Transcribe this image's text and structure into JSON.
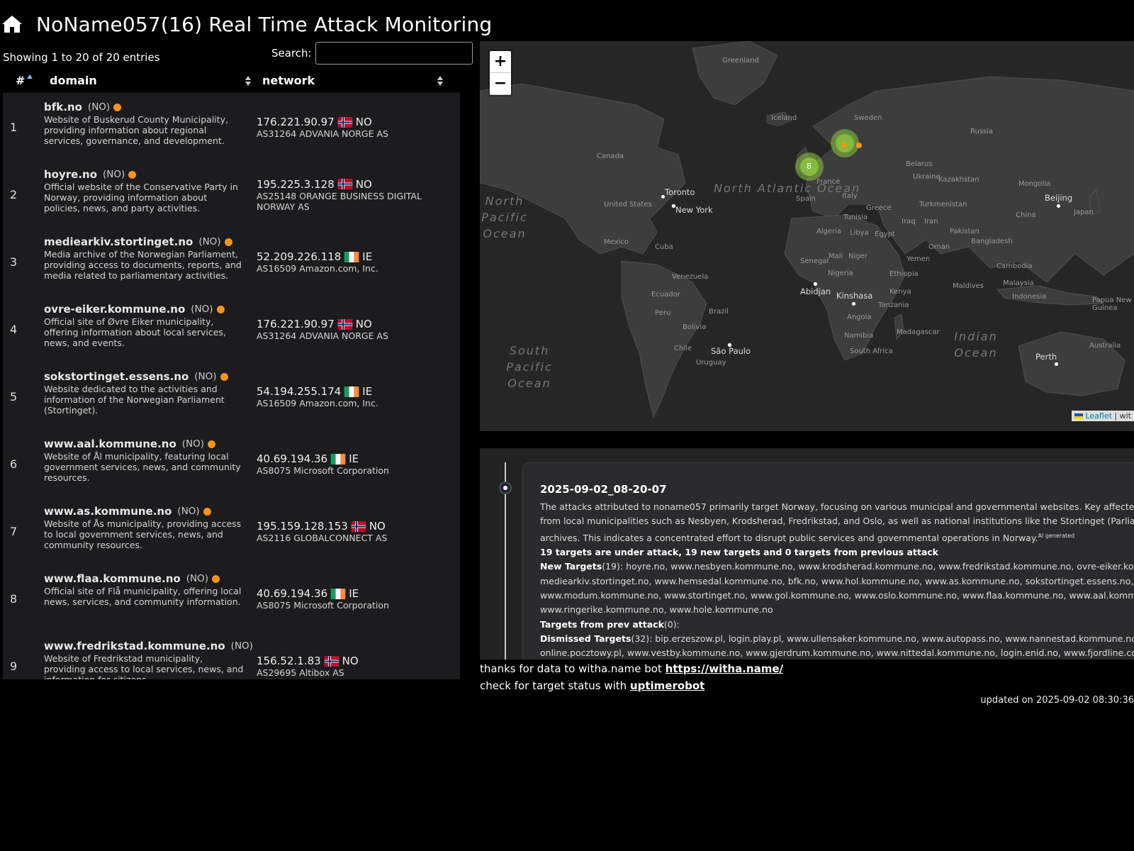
{
  "header": {
    "title": "NoName057(16) Real Time Attack Monitoring",
    "home_icon": "home-icon"
  },
  "table": {
    "entries_info": "Showing 1 to 20 of 20 entries",
    "search_label": "Search:",
    "search_value": "",
    "columns": [
      "#",
      "domain",
      "network"
    ],
    "rows": [
      {
        "num": "1",
        "domain": "bfk.no",
        "cc": "(NO)",
        "desc": "Website of Buskerud County Municipality, providing information about regional services, governance, and development.",
        "ip": "176.221.90.97",
        "country": "NO",
        "asn": "AS31264 ADVANIA NORGE AS"
      },
      {
        "num": "2",
        "domain": "hoyre.no",
        "cc": "(NO)",
        "desc": "Official website of the Conservative Party in Norway, providing information about policies, news, and party activities.",
        "ip": "195.225.3.128",
        "country": "NO",
        "asn": "AS25148 ORANGE BUSINESS DIGITAL NORWAY AS"
      },
      {
        "num": "3",
        "domain": "mediearkiv.stortinget.no",
        "cc": "(NO)",
        "desc": "Media archive of the Norwegian Parliament, providing access to documents, reports, and media related to parliamentary activities.",
        "ip": "52.209.226.118",
        "country": "IE",
        "asn": "AS16509 Amazon.com, Inc."
      },
      {
        "num": "4",
        "domain": "ovre-eiker.kommune.no",
        "cc": "(NO)",
        "desc": "Official site of Øvre Eiker municipality, offering information about local services, news, and events.",
        "ip": "176.221.90.97",
        "country": "NO",
        "asn": "AS31264 ADVANIA NORGE AS"
      },
      {
        "num": "5",
        "domain": "sokstortinget.essens.no",
        "cc": "(NO)",
        "desc": "Website dedicated to the activities and information of the Norwegian Parliament (Stortinget).",
        "ip": "54.194.255.174",
        "country": "IE",
        "asn": "AS16509 Amazon.com, Inc."
      },
      {
        "num": "6",
        "domain": "www.aal.kommune.no",
        "cc": "(NO)",
        "desc": "Website of Ål municipality, featuring local government services, news, and community resources.",
        "ip": "40.69.194.36",
        "country": "IE",
        "asn": "AS8075 Microsoft Corporation"
      },
      {
        "num": "7",
        "domain": "www.as.kommune.no",
        "cc": "(NO)",
        "desc": "Website of Ås municipality, providing access to local government services, news, and community resources.",
        "ip": "195.159.128.153",
        "country": "NO",
        "asn": "AS2116 GLOBALCONNECT AS"
      },
      {
        "num": "8",
        "domain": "www.flaa.kommune.no",
        "cc": "(NO)",
        "desc": "Official site of Flå municipality, offering local news, services, and community information.",
        "ip": "40.69.194.36",
        "country": "IE",
        "asn": "AS8075 Microsoft Corporation"
      },
      {
        "num": "9",
        "domain": "www.fredrikstad.kommune.no",
        "cc": "(NO)",
        "desc": "Website of Fredrikstad municipality, providing access to local services, news, and information for citizens.",
        "ip": "156.52.1.83",
        "country": "NO",
        "asn": "AS29695 Altibox AS"
      }
    ]
  },
  "map": {
    "zoom_in": "+",
    "zoom_out": "−",
    "attribution_link": "Leaflet",
    "attribution_rest": " | wit",
    "cluster_label": "8",
    "labels": [
      {
        "t": "Greenland"
      },
      {
        "t": "Iceland"
      },
      {
        "t": "Sweden"
      },
      {
        "t": "Russia"
      },
      {
        "t": "Canada"
      },
      {
        "t": "Belarus"
      },
      {
        "t": "Ukraine"
      },
      {
        "t": "Kazakhstan"
      },
      {
        "t": "Mongolia"
      },
      {
        "t": "France"
      },
      {
        "t": "Italy"
      },
      {
        "t": "Spain"
      },
      {
        "t": "Greece"
      },
      {
        "t": "Turkmenistan"
      },
      {
        "t": "China"
      },
      {
        "t": "Japan"
      },
      {
        "t": "United States"
      },
      {
        "t": "Tunisia"
      },
      {
        "t": "Iraq"
      },
      {
        "t": "Iran"
      },
      {
        "t": "Pakistan"
      },
      {
        "t": "Algeria"
      },
      {
        "t": "Libya"
      },
      {
        "t": "Egypt"
      },
      {
        "t": "Mexico"
      },
      {
        "t": "Cuba"
      },
      {
        "t": "Oman"
      },
      {
        "t": "Bangladesh"
      },
      {
        "t": "Senegal"
      },
      {
        "t": "Mali"
      },
      {
        "t": "Niger"
      },
      {
        "t": "Yemen"
      },
      {
        "t": "Nigeria"
      },
      {
        "t": "Ethiopia"
      },
      {
        "t": "Cambodia"
      },
      {
        "t": "Venezuela"
      },
      {
        "t": "Maldives"
      },
      {
        "t": "Malaysia"
      },
      {
        "t": "Ecuador"
      },
      {
        "t": "Kenya"
      },
      {
        "t": "Indonesia"
      },
      {
        "t": "Papua New Guinea"
      },
      {
        "t": "Peru"
      },
      {
        "t": "Brazil"
      },
      {
        "t": "Tanzania"
      },
      {
        "t": "Angola"
      },
      {
        "t": "Bolivia"
      },
      {
        "t": "Namibia"
      },
      {
        "t": "Madagascar"
      },
      {
        "t": "Chile"
      },
      {
        "t": "Uruguay"
      },
      {
        "t": "South Africa"
      },
      {
        "t": "Australia"
      }
    ],
    "cities": [
      "Toronto",
      "New York",
      "Beijing",
      "Abidjan",
      "Kinshasa",
      "São Paulo",
      "Perth"
    ],
    "oceans": [
      "North Atlantic Ocean",
      "North Pacific Ocean",
      "South Pacific Ocean",
      "Indian Ocean"
    ]
  },
  "timeline": {
    "date": "2025-09-02_08-20-07",
    "summary_1": "The attacks attributed to noname057 primarily target Norway, focusing on various municipal and governmental websites. Key affected sites include",
    "summary_2": "from local municipalities such as Nesbyen, Krodsherad, Fredrikstad, and Oslo, as well as national institutions like the Stortinget (Parliament) and me",
    "summary_3": "archives. This indicates a concentrated effort to disrupt public services and governmental operations in Norway.",
    "ai_tag": "AI generated",
    "stats": "19 targets are under attack, 19 new targets and 0 targets from previous attack",
    "new_label": "New Targets",
    "new_count": "(19): ",
    "new_1": "hoyre.no, www.nesbyen.kommune.no, www.krodsherad.kommune.no, www.fredrikstad.kommune.no, ovre-eiker.kommune.no,",
    "new_2": "mediearkiv.stortinget.no, www.hemsedal.kommune.no, bfk.no, www.hol.kommune.no, www.as.kommune.no, sokstortinget.essens.no,",
    "new_3": "www.modum.kommune.no, www.stortinget.no, www.gol.kommune.no, www.oslo.kommune.no, www.flaa.kommune.no, www.aal.kommune.no,",
    "new_4": "www.ringerike.kommune.no, www.hole.kommune.no",
    "prev_label": "Targets from prev attack",
    "prev_count": "(0):",
    "dis_label": "Dismissed Targets",
    "dis_count": "(32): ",
    "dis_1": "bip.erzeszow.pl, login.play.pl, www.ullensaker.kommune.no, www.autopass.no, www.nannestad.kommune.no, energa-logis",
    "dis_2": "online.pocztowy.pl, www.vestby.kommune.no, www.gjerdrum.kommune.no, www.nittedal.kommune.no, login.enid.no, www.fjordline.com, nkom.n"
  },
  "footer": {
    "thanks_text": "thanks for data to witha.name bot ",
    "thanks_link": " https://witha.name/",
    "check_text": "check for target status with ",
    "check_link": " uptimerobot",
    "updated": "updated on 2025-09-02 08:30:36"
  },
  "colors": {
    "status_dot": "#f6921e",
    "cluster": "#8dc63f"
  }
}
